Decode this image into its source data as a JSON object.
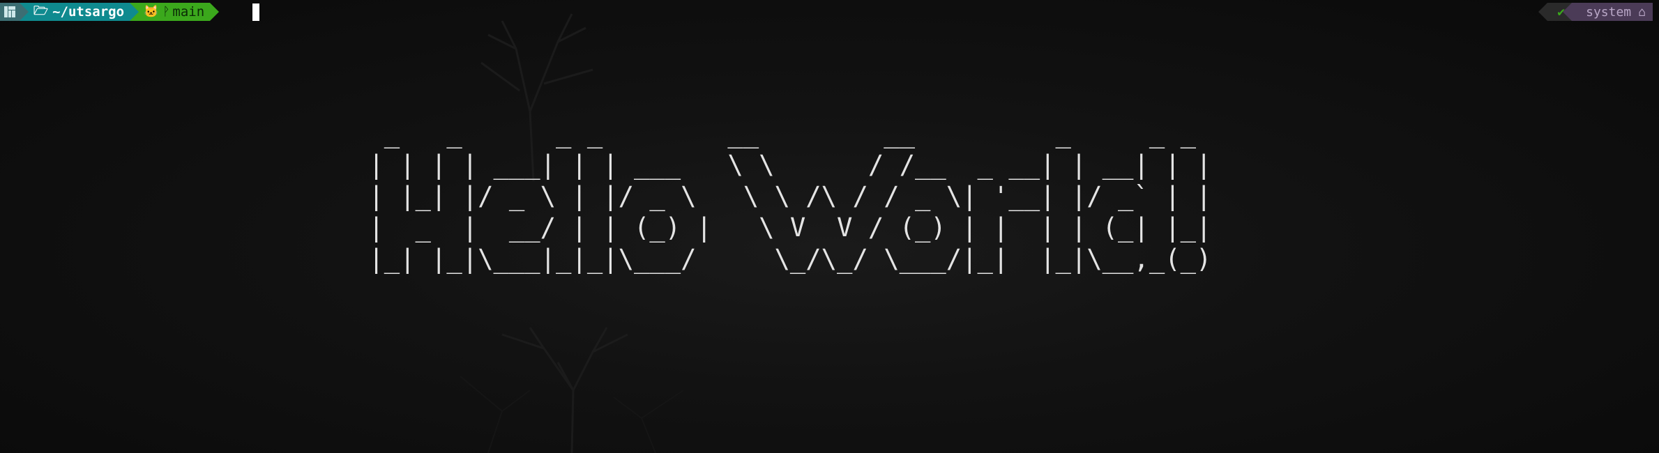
{
  "terminal": {
    "prompt": {
      "os_icon": "manjaro-icon",
      "directory": "~/utsargo",
      "folder_icon": "folder-open-icon",
      "git_icon": "github-icon",
      "branch_icon": "git-branch-icon",
      "branch": "main"
    },
    "right_prompt": {
      "status_icon": "checkmark-icon",
      "status": "✔",
      "context": "system",
      "context_icon": "home-icon"
    },
    "output_lines": [
      "  _   _      _ _        __        __         _     _ _ ",
      " | | | | ___| | | ___   \\ \\      / /__  _ __| | __| | |",
      " | |_| |/ _ \\ | |/ _ \\   \\ \\ /\\ / / _ \\| '__| |/ _` | |",
      " |  _  |  __/ | | (_) |   \\ V  V / (_) | |  | | (_| |_|",
      " |_| |_|\\___|_|_|\\___/     \\_/\\_/ \\___/|_|  |_|\\__,_(_)"
    ]
  },
  "colors": {
    "os_segment": "#3c6e73",
    "dir_segment": "#0f8a8f",
    "git_segment": "#3ba81c",
    "status_segment": "#2a2a2a",
    "context_segment": "#4b3b57",
    "background": "#0b0b0b",
    "ascii_text": "#e4e4e4"
  }
}
